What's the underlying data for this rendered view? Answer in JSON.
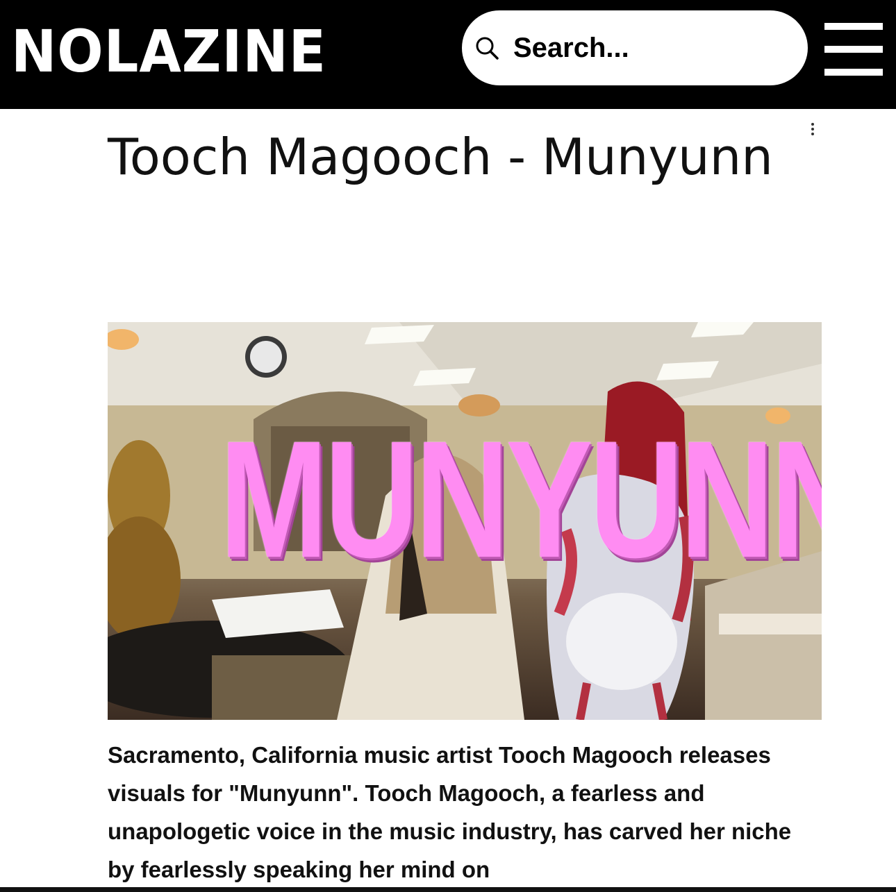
{
  "site": {
    "logo": "NOLAZINE",
    "search_placeholder": "Search...",
    "colors": {
      "header_bg": "#000000",
      "logo": "#ffffff",
      "overlay_text": "#ff8cf2"
    }
  },
  "header": {
    "search_icon": "search-icon",
    "menu_icon": "hamburger-menu-icon"
  },
  "article": {
    "title": "Tooch Magooch - Munyunn",
    "more_icon": "more-vertical-icon",
    "hero": {
      "overlay_text": "MUNYUNN"
    },
    "body": "Sacramento, California music artist Tooch Magooch releases visuals for \"Munyunn\". Tooch Magooch, a fearless and unapologetic voice in the music industry, has carved her niche by fearlessly speaking her mind on"
  }
}
